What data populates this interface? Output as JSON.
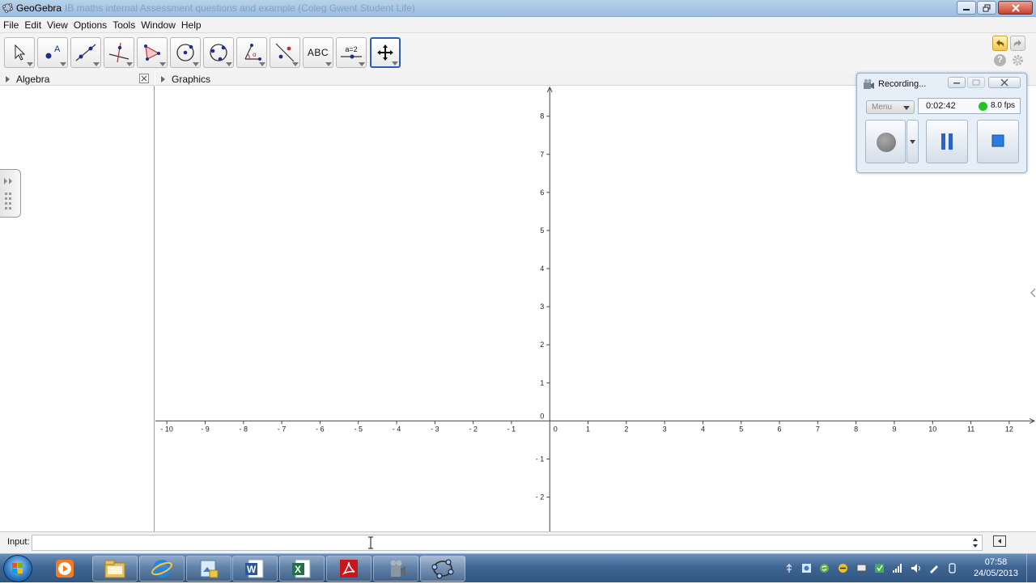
{
  "window": {
    "title": "GeoGebra",
    "ghost_title": "IB maths internal Assessment questions and example (Coleg Gwent Student Life)"
  },
  "menu": [
    "File",
    "Edit",
    "View",
    "Options",
    "Tools",
    "Window",
    "Help"
  ],
  "toolbar": {
    "tools": [
      "move-tool",
      "point-tool",
      "line-tool",
      "perpendicular-tool",
      "polygon-tool",
      "circle-tool",
      "conic-tool",
      "angle-tool",
      "reflect-tool",
      "text-tool",
      "slider-tool",
      "move-view-tool"
    ],
    "text_tool_label": "ABC",
    "slider_tool_label": "a=2",
    "selected": "move-view-tool"
  },
  "views": {
    "algebra": "Algebra",
    "graphics": "Graphics"
  },
  "axes": {
    "x_ticks": [
      -10,
      -9,
      -8,
      -7,
      -6,
      -5,
      -4,
      -3,
      -2,
      -1,
      0,
      1,
      2,
      3,
      4,
      5,
      6,
      7,
      8,
      9,
      10,
      11,
      12
    ],
    "y_ticks": [
      8,
      7,
      6,
      5,
      4,
      3,
      2,
      1,
      0,
      -1,
      -2
    ],
    "x_range": [
      -10.3,
      12.7
    ],
    "y_range": [
      -2.9,
      8.8
    ]
  },
  "recording": {
    "title": "Recording...",
    "menu_label": "Menu",
    "time": "0:02:42",
    "fps": "8.0 fps",
    "status_color": "#22c422"
  },
  "input": {
    "label": "Input:",
    "value": ""
  },
  "taskbar": {
    "apps": [
      "media-player",
      "file-explorer",
      "internet-explorer",
      "image-viewer",
      "word",
      "excel",
      "acrobat",
      "screen-recorder",
      "geogebra"
    ],
    "time": "07:58",
    "date": "24/05/2013"
  }
}
